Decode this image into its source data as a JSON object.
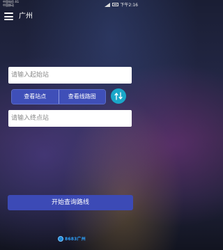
{
  "status_bar": {
    "carrier_line1": "中国电信 4G",
    "carrier_line2": "中国移动",
    "time": "下午2:16"
  },
  "header": {
    "menu_icon": "hamburger-menu-icon",
    "city": "广州"
  },
  "start_input": {
    "placeholder": "请输入起始站"
  },
  "segmented": {
    "view_stations": "查看站点",
    "view_route_map": "查看线路图"
  },
  "swap_icon": "swap-arrows-icon",
  "end_input": {
    "placeholder": "请输入终点站"
  },
  "search_button": {
    "label": "开始查询路线"
  },
  "footer": {
    "logo_text": "8683广州"
  },
  "colors": {
    "primary": "#3f4fb8",
    "accent": "#1aa7c9",
    "input_bg": "#ffffff"
  }
}
